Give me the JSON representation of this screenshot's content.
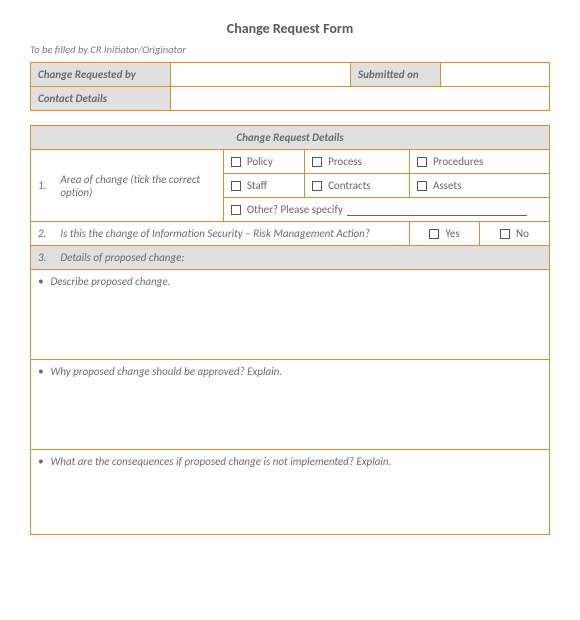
{
  "title": "Change Request Form",
  "subtitle": "To be filled by CR Initiator/Originator",
  "top": {
    "requested_by_label": "Change Requested by",
    "submitted_on_label": "Submitted on",
    "contact_label": "Contact Details"
  },
  "details": {
    "section_title": "Change Request Details",
    "q1_num": "1.",
    "q1_label": "Area of change (tick  the correct option)",
    "opts": {
      "policy": "Policy",
      "process": "Process",
      "procedures": "Procedures",
      "staff": "Staff",
      "contracts": "Contracts",
      "assets": "Assets",
      "other": "Other? Please specify"
    },
    "q2_num": "2.",
    "q2_label": "Is this the change of Information Security – Risk Management Action?",
    "yes": "Yes",
    "no": "No",
    "q3_num": "3.",
    "q3_label": "Details of proposed change:",
    "q3a": "Describe proposed change.",
    "q3b": "Why proposed change should be approved? Explain.",
    "q3c": "What are the consequences if proposed change is not implemented? Explain."
  }
}
